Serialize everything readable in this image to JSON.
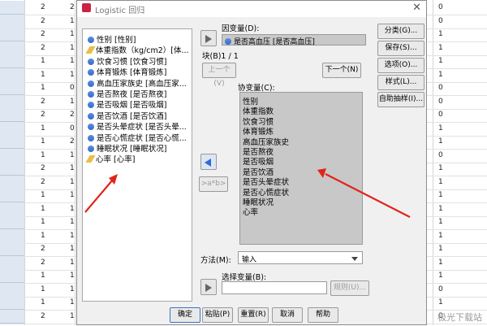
{
  "dialog": {
    "title": "Logistic 回归",
    "close_label": "✕"
  },
  "sheet": {
    "left_values": [
      "2",
      "2",
      "2",
      "2",
      "1",
      "1",
      "1",
      "2",
      "2",
      "1",
      "1",
      "1",
      "2",
      "2",
      "1",
      "1",
      "1",
      "1",
      "2",
      "2",
      "1",
      "1",
      "1",
      "2"
    ],
    "rowhdr_values": [
      "2",
      "1",
      "1",
      "1",
      "1",
      "1",
      "0",
      "1",
      "2",
      "0",
      "2",
      "1",
      "1",
      "1",
      "1",
      "1",
      "1",
      "1",
      "1",
      "1",
      "1",
      "1",
      "1",
      "1"
    ],
    "right_values": [
      "0",
      "0",
      "1",
      "1",
      "1",
      "1",
      "0",
      "0",
      "0",
      "1",
      "1",
      "0",
      "1",
      "1",
      "1",
      "1",
      "1",
      "1",
      "1",
      "1",
      "1",
      "0",
      "1",
      "0"
    ]
  },
  "source_list": [
    {
      "label": "性别 [性别]",
      "icon": "nominal-icon"
    },
    {
      "label": "体重指数（kg/cm2）[体...",
      "icon": "scale-icon"
    },
    {
      "label": "饮食习惯 [饮食习惯]",
      "icon": "nominal-icon"
    },
    {
      "label": "体育锻炼 [体育锻炼]",
      "icon": "nominal-icon"
    },
    {
      "label": "高血压家族史 [高血压家...",
      "icon": "nominal-icon"
    },
    {
      "label": "是否熬夜 [是否熬夜]",
      "icon": "nominal-icon"
    },
    {
      "label": "是否吸烟 [是否吸烟]",
      "icon": "nominal-icon"
    },
    {
      "label": "是否饮酒 [是否饮酒]",
      "icon": "nominal-icon"
    },
    {
      "label": "是否头晕症状 [是否头晕...",
      "icon": "nominal-icon"
    },
    {
      "label": "是否心慌症状 [是否心慌...",
      "icon": "nominal-icon"
    },
    {
      "label": "睡眠状况 [睡眠状况]",
      "icon": "nominal-icon"
    },
    {
      "label": "心率 [心率]",
      "icon": "scale-icon"
    }
  ],
  "dependent": {
    "label": "因变量(D):",
    "value": "是否高血压 [是否高血压]"
  },
  "block": {
    "label": "块(B)1 / 1",
    "prev_label": "上一个(V)",
    "next_label": "下一个(N)"
  },
  "covariates": {
    "label": "协变量(C):",
    "items": [
      "性别",
      "体重指数",
      "饮食习惯",
      "体育锻炼",
      "高血压家族史",
      "是否熬夜",
      "是否吸烟",
      "是否饮酒",
      "是否头晕症状",
      "是否心慌症状",
      "睡眠状况",
      "心率"
    ],
    "interaction_label": ">a*b>"
  },
  "method": {
    "label": "方法(M):",
    "value": "输入"
  },
  "selection": {
    "label": "选择变量(B):",
    "rule_label": "规则(U)..."
  },
  "side_buttons": [
    "分类(G)...",
    "保存(S)...",
    "选项(O)...",
    "样式(L)...",
    "自助抽样(I)..."
  ],
  "bottom_buttons": [
    "确定",
    "粘贴(P)",
    "重置(R)",
    "取消",
    "帮助"
  ],
  "watermark": "极光下载站"
}
